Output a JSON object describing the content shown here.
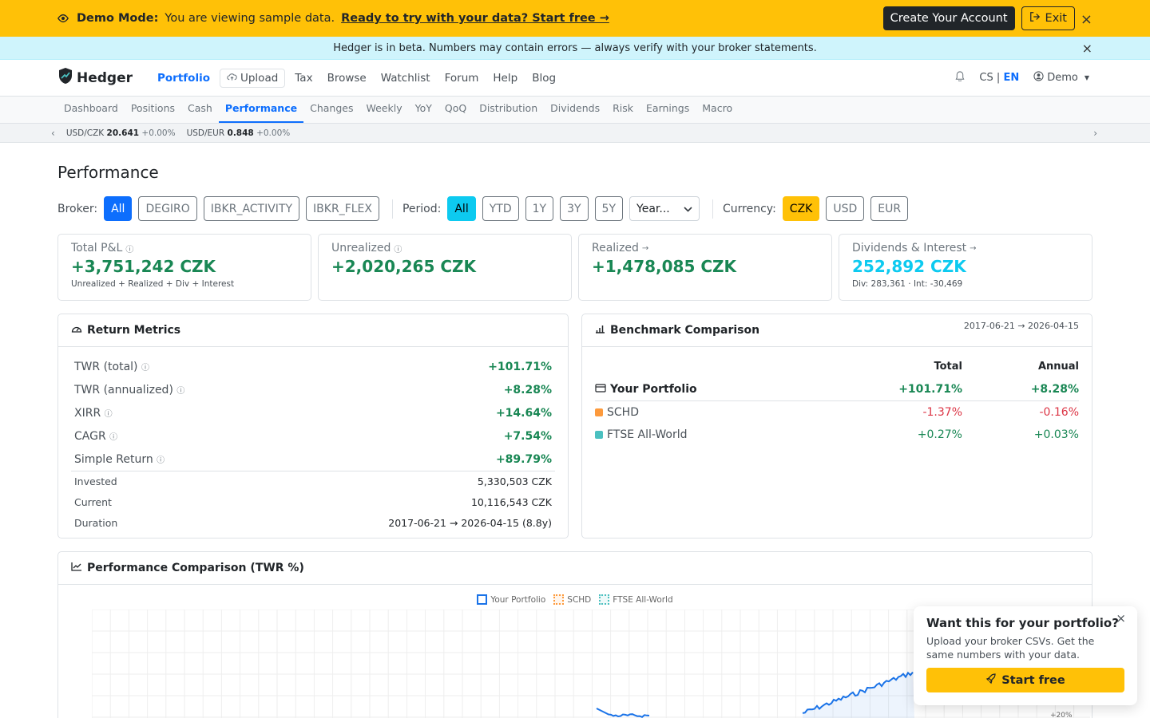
{
  "demo": {
    "title": "Demo Mode:",
    "message": "You are viewing sample data.",
    "cta": "Ready to try with your data? Start free →",
    "create_account": "Create Your Account",
    "exit": "Exit",
    "close": "×"
  },
  "beta": {
    "message": "Hedger is in beta. Numbers may contain errors — always verify with your broker statements.",
    "close": "×"
  },
  "nav": {
    "brand": "Hedger",
    "items": [
      "Portfolio",
      "Upload",
      "Tax",
      "Browse",
      "Watchlist",
      "Forum",
      "Help",
      "Blog"
    ],
    "lang_cs": "CS",
    "lang_sep": "|",
    "lang_en": "EN",
    "user": "Demo"
  },
  "subtabs": [
    "Dashboard",
    "Positions",
    "Cash",
    "Performance",
    "Changes",
    "Weekly",
    "YoY",
    "QoQ",
    "Distribution",
    "Dividends",
    "Risk",
    "Earnings",
    "Macro"
  ],
  "ticker": [
    {
      "pair": "USD/CZK",
      "value": "20.641",
      "change": "+0.00%"
    },
    {
      "pair": "USD/EUR",
      "value": "0.848",
      "change": "+0.00%"
    }
  ],
  "page_title": "Performance",
  "filters": {
    "broker_label": "Broker:",
    "brokers": [
      "All",
      "DEGIRO",
      "IBKR_ACTIVITY",
      "IBKR_FLEX"
    ],
    "period_label": "Period:",
    "periods": [
      "All",
      "YTD",
      "1Y",
      "3Y",
      "5Y"
    ],
    "year_select": "Year...",
    "currency_label": "Currency:",
    "currencies": [
      "CZK",
      "USD",
      "EUR"
    ]
  },
  "kpis": [
    {
      "title": "Total P&L",
      "value": "+3,751,242 CZK",
      "sub": "Unrealized + Realized + Div + Interest"
    },
    {
      "title": "Unrealized",
      "value": "+2,020,265 CZK",
      "sub": ""
    },
    {
      "title": "Realized",
      "value": "+1,478,085 CZK",
      "sub": ""
    },
    {
      "title": "Dividends & Interest",
      "value": "252,892 CZK",
      "sub": "Div: 283,361 · Int: -30,469"
    }
  ],
  "return_metrics": {
    "title": "Return Metrics",
    "rows": [
      {
        "label": "TWR (total)",
        "value": "+101.71%"
      },
      {
        "label": "TWR (annualized)",
        "value": "+8.28%"
      },
      {
        "label": "XIRR",
        "value": "+14.64%"
      },
      {
        "label": "CAGR",
        "value": "+7.54%"
      },
      {
        "label": "Simple Return",
        "value": "+89.79%"
      }
    ],
    "details": [
      {
        "label": "Invested",
        "value": "5,330,503 CZK"
      },
      {
        "label": "Current",
        "value": "10,116,543 CZK"
      },
      {
        "label": "Duration",
        "value": "2017-06-21 → 2026-04-15 (8.8y)"
      }
    ]
  },
  "benchmark": {
    "title": "Benchmark Comparison",
    "date_range": "2017-06-21 → 2026-04-15",
    "col_total": "Total",
    "col_annual": "Annual",
    "rows": [
      {
        "name": "Your Portfolio",
        "total": "+101.71%",
        "annual": "+8.28%",
        "color": "#212529"
      },
      {
        "name": "SCHD",
        "total": "-1.37%",
        "annual": "-0.16%",
        "color": "#fd9a3c"
      },
      {
        "name": "FTSE All-World",
        "total": "+0.27%",
        "annual": "+0.03%",
        "color": "#4bc0c0"
      }
    ]
  },
  "perf_chart": {
    "title": "Performance Comparison (TWR %)",
    "legend": [
      {
        "name": "Your Portfolio",
        "color": "#1a73e8"
      },
      {
        "name": "SCHD",
        "color": "#fd9a3c"
      },
      {
        "name": "FTSE All-World",
        "color": "#4bc0c0"
      }
    ],
    "y_tick_visible": "+20%"
  },
  "popup": {
    "title": "Want this for your portfolio?",
    "desc": "Upload your broker CSVs. Get the same numbers with your data.",
    "button": "Start free",
    "close": "×"
  }
}
